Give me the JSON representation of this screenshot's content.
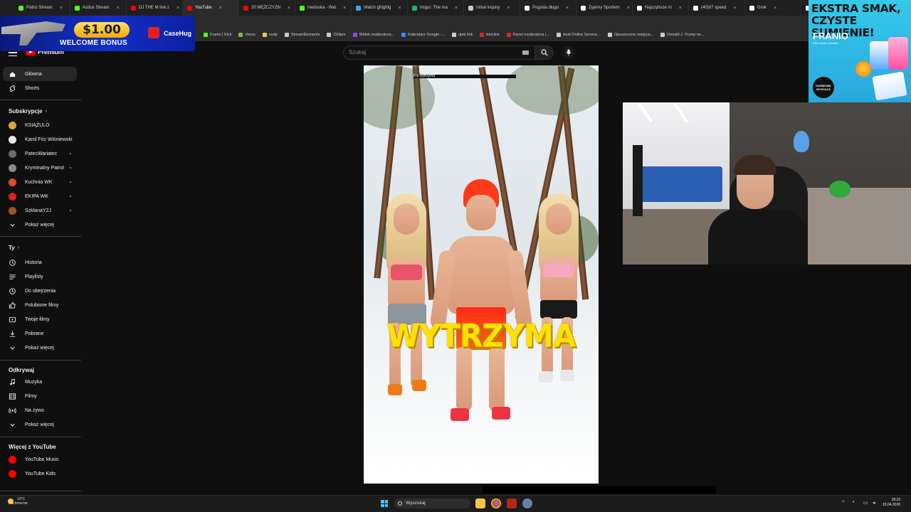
{
  "browser": {
    "tabs": [
      {
        "label": "Patiro Stream",
        "color": "#53fc18"
      },
      {
        "label": "Azdus Stream",
        "color": "#53fc18"
      },
      {
        "label": "DJ THE M live z",
        "color": "#ff0000"
      },
      {
        "label": "YouTube",
        "color": "#ff0000",
        "active": true
      },
      {
        "label": "20 MĘŻCZYZN",
        "color": "#ff0000"
      },
      {
        "label": "meduska - Wat",
        "color": "#53fc18"
      },
      {
        "label": "Watch gfdgfdg",
        "color": "#3ea6ff"
      },
      {
        "label": "Imgur: The ma",
        "color": "#1bb76e"
      },
      {
        "label": "Initial inquiry",
        "color": "#cccccc"
      },
      {
        "label": "Pogoda długo",
        "color": "#ffffff"
      },
      {
        "label": "Żyjemy Sportem",
        "color": "#ffffff"
      },
      {
        "label": "Najszybsze ro",
        "color": "#ffffff"
      },
      {
        "label": "(40)67 speed",
        "color": "#ffffff"
      },
      {
        "label": "Grok",
        "color": "#ffffff"
      },
      {
        "label": "(40)#gbs",
        "color": "#ffffff"
      }
    ],
    "bookmarks": [
      {
        "label": "Franio | Kick",
        "color": "#53fc18"
      },
      {
        "label": "chess",
        "color": "#81b64c"
      },
      {
        "label": "nudy",
        "color": "#f2c744"
      },
      {
        "label": "StreamElements",
        "color": "#cccccc"
      },
      {
        "label": "Chilam",
        "color": "#cccccc"
      },
      {
        "label": "Widok moderatora...",
        "color": "#9146ff"
      },
      {
        "label": "Kalendarz Google -...",
        "color": "#4285f4"
      },
      {
        "label": "ujeb link",
        "color": "#cccccc"
      },
      {
        "label": "betclick",
        "color": "#e02020"
      },
      {
        "label": "Panel moderatora |...",
        "color": "#e02020"
      },
      {
        "label": "Audi Online Service...",
        "color": "#cccccc"
      },
      {
        "label": "Opuszczone miejsca...",
        "color": "#cccccc"
      },
      {
        "label": "Donald J. Trump ne...",
        "color": "#cccccc"
      }
    ]
  },
  "bonus": {
    "amount": "$1.00",
    "label": "WELCOME BONUS",
    "brand": "CaseHug"
  },
  "ad": {
    "headline": "EKSTRA SMAK, CZYSTE SUMIENIE!",
    "brand": "FRANIO",
    "sub": "10% zniżki z kodem",
    "badge": "DARMOWA WYSYŁKA"
  },
  "youtube": {
    "logo": "Premium",
    "search_placeholder": "Szukaj",
    "sidebar": {
      "main": [
        {
          "label": "Główna",
          "icon": "home-icon",
          "active": true
        },
        {
          "label": "Shorts",
          "icon": "shorts-icon"
        }
      ],
      "subs_title": "Subskrypcje",
      "subs": [
        {
          "label": "KSIĄŻULO",
          "color": "#d9a441",
          "dot": false
        },
        {
          "label": "Karol Friz Wiśniewski",
          "color": "#e8e8e8",
          "dot": false
        },
        {
          "label": "PatecWariatec",
          "color": "#6b6b6b",
          "dot": true
        },
        {
          "label": "Kryminalny Patrol",
          "color": "#8a8a8a",
          "dot": true
        },
        {
          "label": "Kuchnia WK",
          "color": "#e34a2b",
          "dot": true
        },
        {
          "label": "EKIPA WK",
          "color": "#e02020",
          "dot": true
        },
        {
          "label": "SzklanaY2J",
          "color": "#a0522d",
          "dot": true
        }
      ],
      "subs_more": "Pokaż więcej",
      "you_title": "Ty",
      "you": [
        {
          "label": "Historia",
          "icon": "history-icon"
        },
        {
          "label": "Playlisty",
          "icon": "playlist-icon"
        },
        {
          "label": "Do obejrzenia",
          "icon": "clock-icon"
        },
        {
          "label": "Polubione filmy",
          "icon": "thumb-up-icon"
        },
        {
          "label": "Twoje filmy",
          "icon": "video-icon"
        },
        {
          "label": "Pobrane",
          "icon": "download-icon"
        },
        {
          "label": "Pokaż więcej",
          "icon": "chevron-down-icon"
        }
      ],
      "explore_title": "Odkrywaj",
      "explore": [
        {
          "label": "Muzyka",
          "icon": "music-icon"
        },
        {
          "label": "Filmy",
          "icon": "film-icon"
        },
        {
          "label": "Na żywo",
          "icon": "live-icon"
        },
        {
          "label": "Pokaż więcej",
          "icon": "chevron-down-icon"
        }
      ],
      "more_title": "Więcej z YouTube",
      "more": [
        {
          "label": "YouTube Music",
          "color": "#ff0000"
        },
        {
          "label": "YouTube Kids",
          "color": "#ff0000"
        }
      ]
    },
    "video": {
      "caption": "Kto wytrzyma",
      "title": "WYTRZYMA"
    }
  },
  "taskbar": {
    "weather_temp": "13°C",
    "weather_desc": "Pochmurnie",
    "search": "Wyszukaj",
    "time": "18:23",
    "date": "15.04.2026"
  }
}
